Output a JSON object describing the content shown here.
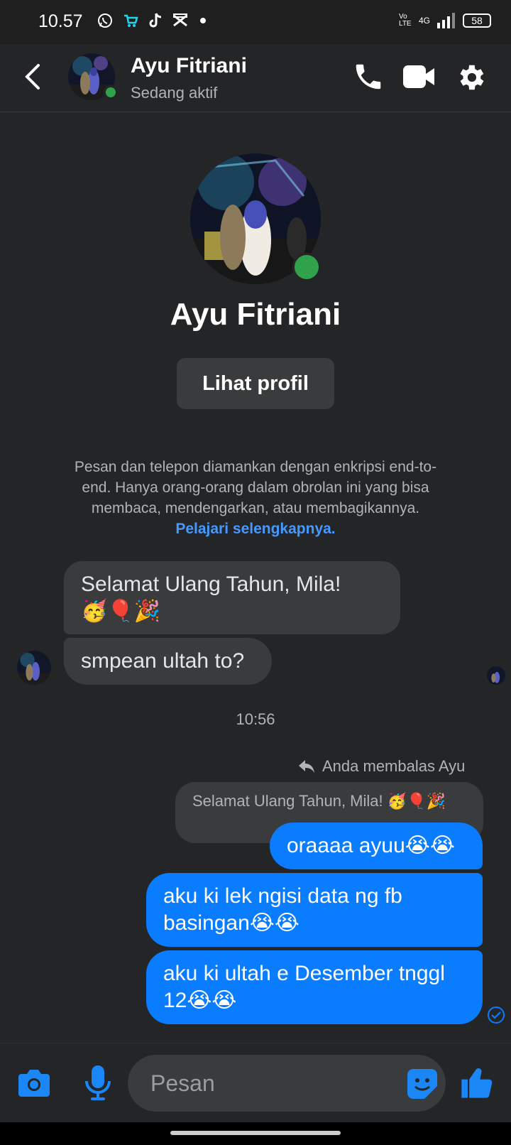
{
  "status_bar": {
    "time": "10.57",
    "network": "4G",
    "volte": "Vo LTE",
    "battery": "58",
    "notification_icons": [
      "whatsapp-icon",
      "shop-icon",
      "tiktok-icon",
      "capcut-icon",
      "dot-icon"
    ]
  },
  "header": {
    "contact_name": "Ayu Fitriani",
    "status": "Sedang aktif",
    "icons": [
      "back-arrow-icon",
      "phone-icon",
      "video-icon",
      "settings-gear-icon"
    ]
  },
  "profile": {
    "name": "Ayu Fitriani",
    "view_profile_button": "Lihat profil"
  },
  "encryption_notice": {
    "text": "Pesan dan telepon diamankan dengan enkripsi end-to-end. Hanya orang-orang dalam obrolan ini yang bisa membaca, mendengarkan, atau membagikannya.",
    "link": "Pelajari selengkapnya."
  },
  "messages": {
    "incoming": [
      {
        "text": "Selamat Ulang Tahun, Mila!",
        "emoji": "🥳🎈🎉"
      },
      {
        "text": "smpean ultah to?"
      }
    ],
    "time_separator": "10:56",
    "reply_note": "Anda membalas Ayu",
    "reply_quote": "Selamat Ulang Tahun, Mila! 🥳🎈🎉",
    "outgoing": [
      {
        "text": "oraaaa ayuu😭😭"
      },
      {
        "line1": "aku ki lek ngisi data ng fb",
        "line2": "basingan😭😭"
      },
      {
        "line1": "aku ki ultah e Desember tnggl",
        "line2": "12😭😭"
      }
    ]
  },
  "composer": {
    "placeholder": "Pesan",
    "icons": [
      "camera-icon",
      "microphone-icon",
      "sticker-icon",
      "thumbs-up-icon"
    ]
  },
  "colors": {
    "background": "#242527",
    "incoming_bubble": "#3a3b3c",
    "outgoing_bubble": "#0a7cff",
    "active_dot": "#31a24c",
    "link": "#4599ff"
  }
}
